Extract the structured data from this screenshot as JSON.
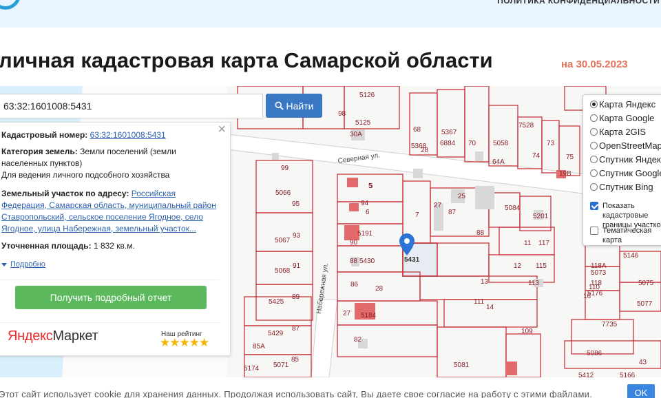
{
  "header": {
    "privacy_link": "ПОЛИТИКА КОНФИДЕНЦИАЛЬНОСТИ"
  },
  "page": {
    "title": "личная кадастровая карта Самарской области",
    "date": "на 30.05.2023"
  },
  "search": {
    "value": "63:32:1601008:5431",
    "button_label": "Найти",
    "button_icon": "search-icon"
  },
  "info": {
    "cadastral_label": "Кадастровый номер:",
    "cadastral_value": "63:32:1601008:5431",
    "category_label": "Категория земель:",
    "category_value": "Земли поселений (земли населенных пунктов)",
    "use_value": "Для ведения личного подсобного хозяйства",
    "address_label": "Земельный участок по адресу:",
    "address_value": "Российская Федерация, Самарская область, муниципальный район Ставропольский, сельское поселение Ягодное, село Ягодное, улица Набережная, земельный участок...",
    "area_label": "Уточненная площадь:",
    "area_value": "1 832 кв.м.",
    "more_label": "Подробно",
    "report_button": "Получить подробный отчет",
    "market_brand_a": "Яндекс",
    "market_brand_b": "Маркет",
    "rating_label": "Наш рейтинг",
    "rating_stars": "★★★★★",
    "rating_value": 5,
    "close_glyph": "×"
  },
  "layers": {
    "radio_options": [
      {
        "label": "Карта Яндекс",
        "selected": true
      },
      {
        "label": "Карта Google",
        "selected": false
      },
      {
        "label": "Карта 2GIS",
        "selected": false
      },
      {
        "label": "OpenStreetMap",
        "selected": false
      },
      {
        "label": "Спутник Яндекс",
        "selected": false
      },
      {
        "label": "Спутник Google",
        "selected": false
      },
      {
        "label": "Спутник Bing",
        "selected": false
      }
    ],
    "show_borders_label": "Показать кадастровые границы участков",
    "show_borders_checked": true,
    "thematic_label": "Тематическая карта",
    "thematic_checked": false
  },
  "map": {
    "streets": [
      "Северная ул.",
      "Набережная ул."
    ],
    "parcel_labels": [
      "5126",
      "5125",
      "68",
      "5367",
      "6884",
      "5368",
      "28",
      "70",
      "5058",
      "7528",
      "73",
      "74",
      "75",
      "64А",
      "98",
      "30А",
      "99",
      "5066",
      "95",
      "5",
      "94",
      "6",
      "7",
      "27",
      "25",
      "87",
      "5084",
      "5201",
      "5",
      "5191",
      "5067",
      "93",
      "90",
      "88",
      "11",
      "117",
      "5431",
      "88",
      "5430",
      "91",
      "12",
      "115",
      "5068",
      "86",
      "28",
      "13",
      "113",
      "111",
      "14",
      "89",
      "5425",
      "27",
      "5184",
      "109",
      "87",
      "5429",
      "82",
      "85А",
      "85",
      "5071",
      "5174",
      "5081",
      "5146",
      "118А",
      "5073",
      "110",
      "5075",
      "5176",
      "5077",
      "7735",
      "5086",
      "43",
      "5412",
      "19В",
      "118",
      "16",
      "5166"
    ]
  },
  "cookie": {
    "text": "Этот сайт использует cookie для хранения данных. Продолжая использовать сайт, Вы даете свое согласие на работу с этими файлами.",
    "ok_label": "OK"
  },
  "colors": {
    "accent": "#3b78c3",
    "parcel_border": "#c8323a",
    "building": "#e26a6a",
    "date": "#e0745a",
    "report_button": "#5cb85c",
    "topbar": "#e9f5fd",
    "marker": "#2b74d6"
  }
}
